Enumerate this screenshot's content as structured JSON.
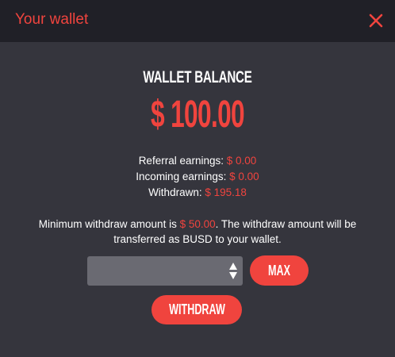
{
  "header": {
    "title": "Your wallet",
    "close_icon": "close-icon"
  },
  "balance": {
    "label": "WALLET BALANCE",
    "value": "$ 100.00"
  },
  "stats": {
    "referral_label": "Referral earnings:",
    "referral_value": "$ 0.00",
    "incoming_label": "Incoming earnings:",
    "incoming_value": "$ 0.00",
    "withdrawn_label": "Withdrawn:",
    "withdrawn_value": "$ 195.18"
  },
  "info": {
    "prefix": "Minimum withdraw amount is",
    "min_amount": "$ 50.00",
    "suffix": ". The withdraw amount will be transferred as BUSD to your wallet."
  },
  "amount_input": {
    "value": "",
    "placeholder": ""
  },
  "buttons": {
    "max_label": "MAX",
    "withdraw_label": "WITHDRAW"
  },
  "colors": {
    "accent": "#f0443e",
    "background": "#35353d",
    "header_background": "#202027",
    "input_background": "#6a6a72"
  }
}
